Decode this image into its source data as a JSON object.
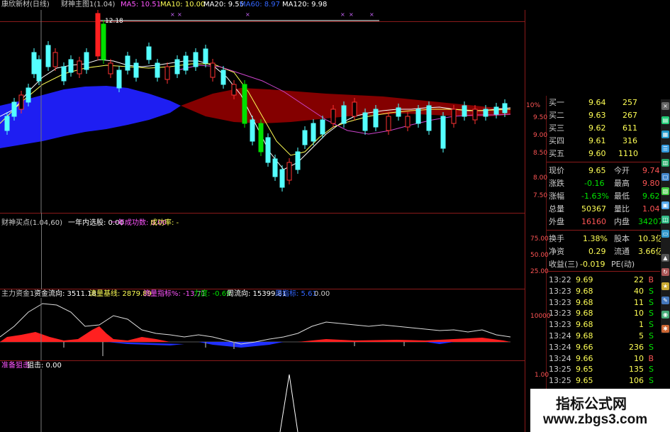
{
  "header": {
    "title": "康欣新材(日线)",
    "indicator": "财神主图1(1.04)",
    "ma5_label": "MA5: 10.51",
    "ma10_label": "MA10: 10.00",
    "ma20_label": "MA20: 9.55",
    "ma60_label": "MA60: 8.97",
    "ma120_label": "MA120: 9.98",
    "peak_label": "12.18"
  },
  "price_axis": [
    "10%",
    "9.50",
    "9.00",
    "8.50",
    "8.00",
    "7.50"
  ],
  "panel2": {
    "name": "财神买点(1.04,60)",
    "field1": "一年内选股: 0.00",
    "field2": "一年成功数: 0.00",
    "field3": "成功率: -",
    "axis": [
      "75.00",
      "50.00",
      "25.00"
    ]
  },
  "panel3": {
    "name": "主力资金1",
    "f1": "资金流向: 3511.18",
    "f2": "流量基线: 2879.89",
    "f3": "流量指标%: -13.71",
    "f4": "力度: -0.69",
    "f5": "周流向: 15399.81",
    "f6": "周指标: 5.61",
    "f7": "0.00",
    "axis": [
      "10000"
    ]
  },
  "panel4": {
    "name": "准备狙击",
    "f1": "狙击: 0.00",
    "axis": [
      "1.00"
    ]
  },
  "quote": {
    "bids": [
      {
        "label": "买一",
        "price": "9.64",
        "vol": "257"
      },
      {
        "label": "买二",
        "price": "9.63",
        "vol": "267"
      },
      {
        "label": "买三",
        "price": "9.62",
        "vol": "611"
      },
      {
        "label": "买四",
        "price": "9.61",
        "vol": "316"
      },
      {
        "label": "买五",
        "price": "9.60",
        "vol": "1110"
      }
    ],
    "stats": [
      {
        "k1": "现价",
        "v1": "9.65",
        "k2": "今开",
        "v2": "9.74"
      },
      {
        "k1": "涨跌",
        "v1": "-0.16",
        "k2": "最高",
        "v2": "9.80"
      },
      {
        "k1": "涨幅",
        "v1": "-1.63%",
        "k2": "最低",
        "v2": "9.62"
      },
      {
        "k1": "总量",
        "v1": "50367",
        "k2": "量比",
        "v2": "1.04"
      },
      {
        "k1": "外盘",
        "v1": "16160",
        "k2": "内盘",
        "v2": "34207"
      }
    ],
    "stats2": [
      {
        "k1": "换手",
        "v1": "1.38%",
        "k2": "股本",
        "v2": "10.3亿"
      },
      {
        "k1": "净资",
        "v1": "0.29",
        "k2": "流通",
        "v2": "3.66亿"
      },
      {
        "k1": "收益(三)",
        "v1": "-0.019",
        "k2": "PE(动)",
        "v2": ""
      }
    ]
  },
  "ticks": [
    {
      "t": "13:22",
      "p": "9.69",
      "v": "22",
      "s": "B"
    },
    {
      "t": "13:23",
      "p": "9.68",
      "v": "40",
      "s": "S"
    },
    {
      "t": "13:23",
      "p": "9.68",
      "v": "11",
      "s": "S"
    },
    {
      "t": "13:23",
      "p": "9.68",
      "v": "10",
      "s": "S"
    },
    {
      "t": "13:23",
      "p": "9.68",
      "v": "1",
      "s": "S"
    },
    {
      "t": "13:24",
      "p": "9.68",
      "v": "5",
      "s": "S"
    },
    {
      "t": "13:24",
      "p": "9.66",
      "v": "236",
      "s": "S"
    },
    {
      "t": "13:24",
      "p": "9.66",
      "v": "10",
      "s": "B"
    },
    {
      "t": "13:25",
      "p": "9.65",
      "v": "135",
      "s": "S"
    },
    {
      "t": "13:25",
      "p": "9.65",
      "v": "106",
      "s": "S"
    }
  ],
  "watermark": {
    "line1": "指标公式网",
    "line2": "www.zbgs3.com"
  },
  "colors": {
    "up": "#ff3232",
    "down": "#54ffff",
    "grid": "#8b1a1a",
    "yellow": "#ffff00",
    "green": "#00e600"
  }
}
